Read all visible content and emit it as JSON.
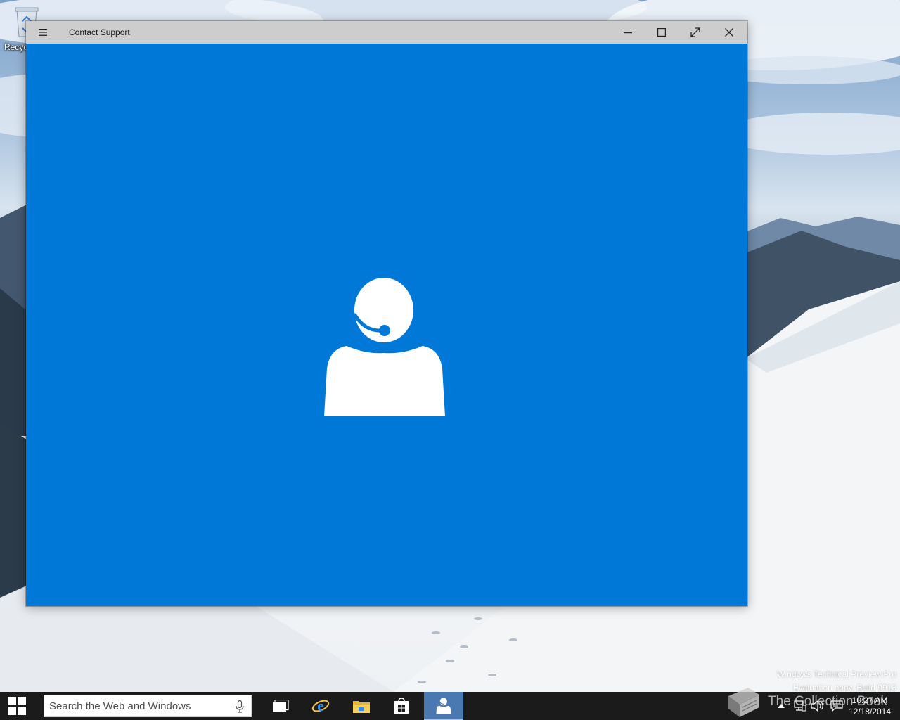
{
  "desktop": {
    "recycle_bin_label": "Recyc"
  },
  "window": {
    "title": "Contact Support",
    "menu_icon": "hamburger-menu-icon",
    "controls": {
      "minimize_icon": "minimize-icon",
      "maximize_icon": "maximize-icon",
      "fullscreen_icon": "fullscreen-icon",
      "close_icon": "close-icon"
    },
    "background_color": "#0078d7",
    "splash_icon": "support-agent-headset-icon"
  },
  "watermark": {
    "line1": "Windows Technical Preview Pro",
    "line2": "Evaluation copy. Build 9913"
  },
  "taskbar": {
    "search": {
      "placeholder": "Search the Web and Windows"
    },
    "apps": [
      {
        "name": "Task View",
        "icon": "task-view-icon"
      },
      {
        "name": "Internet Explorer",
        "icon": "internet-explorer-icon"
      },
      {
        "name": "File Explorer",
        "icon": "file-explorer-icon"
      },
      {
        "name": "Store",
        "icon": "store-icon"
      },
      {
        "name": "Contact Support",
        "icon": "contact-support-icon",
        "active": true
      }
    ],
    "clock": {
      "time": "10:27 AM",
      "date": "12/18/2014"
    }
  },
  "overlay": {
    "brand_text": "The Collection Book"
  }
}
